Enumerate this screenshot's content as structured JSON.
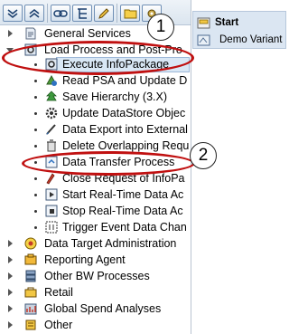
{
  "toolbar": {
    "buttons": [
      {
        "icon": "expand-all-icon"
      },
      {
        "icon": "collapse-all-icon"
      },
      {
        "icon": "link-icon"
      },
      {
        "icon": "hierarchy-icon"
      },
      {
        "icon": "edit-icon"
      },
      {
        "icon": "folder-icon"
      },
      {
        "icon": "settings-icon"
      }
    ]
  },
  "tree": {
    "general_services": "General Services",
    "load_process": "Load Process and Post-Pro",
    "children": [
      {
        "label": "Execute InfoPackage",
        "icon": "infopackage-icon"
      },
      {
        "label": "Read PSA and Update D",
        "icon": "read-psa-icon"
      },
      {
        "label": "Save Hierarchy (3.X)",
        "icon": "hierarchy-tree-icon"
      },
      {
        "label": "Update DataStore Objec",
        "icon": "gear-icon"
      },
      {
        "label": "Data Export into External",
        "icon": "export-icon"
      },
      {
        "label": "Delete Overlapping Requ",
        "icon": "trash-icon"
      },
      {
        "label": "Data Transfer Process",
        "icon": "dtp-icon"
      },
      {
        "label": "Close Request of InfoPa",
        "icon": "close-request-icon"
      },
      {
        "label": "Start Real-Time Data Ac",
        "icon": "start-realtime-icon"
      },
      {
        "label": "Stop Real-Time Data Ac",
        "icon": "stop-realtime-icon"
      },
      {
        "label": "Trigger Event Data Chan",
        "icon": "trigger-event-icon"
      }
    ],
    "bottom": [
      {
        "label": "Data Target Administration",
        "icon": "target-admin-icon"
      },
      {
        "label": "Reporting Agent",
        "icon": "reporting-agent-icon"
      },
      {
        "label": "Other BW Processes",
        "icon": "other-processes-icon"
      },
      {
        "label": "Retail",
        "icon": "retail-icon"
      },
      {
        "label": "Global Spend Analyses",
        "icon": "spend-analyses-icon"
      },
      {
        "label": "Other",
        "icon": "other-icon"
      }
    ]
  },
  "variants": {
    "start": "Start",
    "demo": "Demo Variant"
  },
  "annotations": {
    "badge_1": "1",
    "badge_2": "2",
    "color": "#c01010"
  }
}
